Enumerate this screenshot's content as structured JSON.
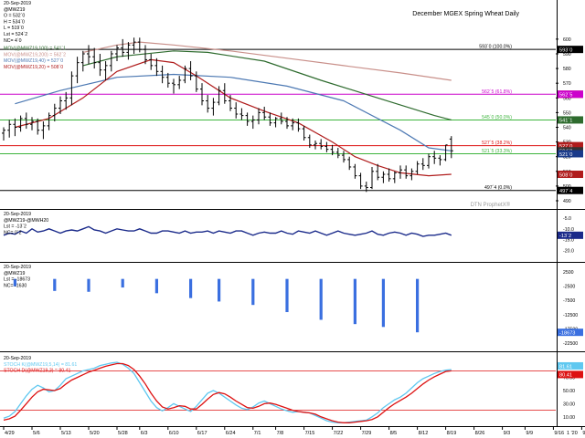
{
  "chart_data": [
    {
      "type": "ohlc",
      "title": "December MGEX Spring Wheat Daily",
      "header": [
        "20-Sep-2019",
        "@MWZ19",
        "O = 532`0",
        "H = 534`0",
        "L = 519`0",
        "Lst = 524`2",
        "NC= 4`0"
      ],
      "legend": [
        {
          "label": "MOV(@MWZ19,100) = 541`1",
          "color": "#2e6b2e"
        },
        {
          "label": "MOV(@MWZ19,200) = 562`2",
          "color": "#c9908a"
        },
        {
          "label": "MOV(@MWZ19,40) = 527`0",
          "color": "#4d79b3"
        },
        {
          "label": "MOV(@MWZ19,20) = 508`0",
          "color": "#b01c1c"
        }
      ],
      "bars": [
        [
          536,
          540,
          531,
          538
        ],
        [
          538,
          545,
          533,
          542
        ],
        [
          542,
          546,
          534,
          540
        ],
        [
          540,
          548,
          537,
          546
        ],
        [
          546,
          550,
          539,
          542
        ],
        [
          542,
          547,
          538,
          544
        ],
        [
          544,
          546,
          535,
          538
        ],
        [
          538,
          544,
          532,
          541
        ],
        [
          541,
          550,
          538,
          548
        ],
        [
          548,
          556,
          544,
          553
        ],
        [
          553,
          561,
          549,
          558
        ],
        [
          558,
          564,
          552,
          560
        ],
        [
          560,
          578,
          555,
          575
        ],
        [
          575,
          588,
          570,
          584
        ],
        [
          584,
          592,
          578,
          590
        ],
        [
          590,
          596,
          583,
          588
        ],
        [
          588,
          594,
          580,
          584
        ],
        [
          584,
          590,
          575,
          579
        ],
        [
          579,
          585,
          572,
          582
        ],
        [
          582,
          592,
          578,
          590
        ],
        [
          590,
          596,
          585,
          594
        ],
        [
          594,
          600,
          588,
          591
        ],
        [
          591,
          598,
          586,
          596
        ],
        [
          596,
          601,
          590,
          598
        ],
        [
          598,
          601,
          591,
          593
        ],
        [
          593,
          596,
          583,
          586
        ],
        [
          586,
          590,
          579,
          582
        ],
        [
          582,
          587,
          575,
          578
        ],
        [
          578,
          582,
          570,
          574
        ],
        [
          574,
          577,
          567,
          570
        ],
        [
          570,
          573,
          563,
          569
        ],
        [
          569,
          575,
          566,
          572
        ],
        [
          572,
          582,
          570,
          580
        ],
        [
          580,
          585,
          572,
          575
        ],
        [
          575,
          578,
          564,
          566
        ],
        [
          566,
          570,
          555,
          558
        ],
        [
          558,
          562,
          550,
          553
        ],
        [
          553,
          560,
          548,
          557
        ],
        [
          557,
          568,
          555,
          565
        ],
        [
          565,
          570,
          556,
          558
        ],
        [
          558,
          562,
          551,
          553
        ],
        [
          553,
          557,
          546,
          549
        ],
        [
          549,
          553,
          545,
          548
        ],
        [
          548,
          550,
          541,
          544
        ],
        [
          544,
          548,
          539,
          545
        ],
        [
          545,
          553,
          542,
          550
        ],
        [
          550,
          554,
          545,
          547
        ],
        [
          547,
          550,
          541,
          543
        ],
        [
          543,
          547,
          540,
          546
        ],
        [
          546,
          550,
          542,
          544
        ],
        [
          544,
          547,
          539,
          541
        ],
        [
          541,
          546,
          538,
          543
        ],
        [
          543,
          546,
          537,
          539
        ],
        [
          539,
          541,
          531,
          533
        ],
        [
          533,
          535,
          526,
          528
        ],
        [
          528,
          531,
          525,
          529
        ],
        [
          529,
          532,
          525,
          527
        ],
        [
          527,
          530,
          523,
          525
        ],
        [
          525,
          528,
          521,
          523
        ],
        [
          523,
          526,
          519,
          521
        ],
        [
          521,
          524,
          516,
          518
        ],
        [
          518,
          520,
          511,
          513
        ],
        [
          513,
          515,
          505,
          507
        ],
        [
          507,
          509,
          498,
          500
        ],
        [
          500,
          503,
          496,
          499
        ],
        [
          499,
          513,
          498,
          510
        ],
        [
          510,
          515,
          504,
          506
        ],
        [
          506,
          510,
          502,
          508
        ],
        [
          508,
          512,
          503,
          505
        ],
        [
          505,
          510,
          502,
          509
        ],
        [
          509,
          514,
          505,
          511
        ],
        [
          511,
          514,
          505,
          507
        ],
        [
          507,
          512,
          504,
          510
        ],
        [
          510,
          517,
          508,
          515
        ],
        [
          515,
          519,
          511,
          514
        ],
        [
          514,
          522,
          512,
          520
        ],
        [
          520,
          524,
          515,
          519
        ],
        [
          519,
          521,
          514,
          518
        ],
        [
          518,
          528,
          517,
          528
        ],
        [
          532,
          534,
          519,
          524
        ]
      ],
      "ma": [
        {
          "name": "MOV 100",
          "color": "#2e6b2e",
          "points": [
            [
              14,
              582
            ],
            [
              20,
              588
            ],
            [
              30,
              592
            ],
            [
              36,
              591
            ],
            [
              46,
              585
            ],
            [
              56,
              572
            ],
            [
              66,
              560
            ],
            [
              76,
              548
            ],
            [
              79,
              545
            ]
          ]
        },
        {
          "name": "MOV 200",
          "color": "#c9908a",
          "points": [
            [
              14,
              591
            ],
            [
              20,
              596
            ],
            [
              24,
              598
            ],
            [
              30,
              596
            ],
            [
              40,
              592
            ],
            [
              50,
              587
            ],
            [
              60,
              582
            ],
            [
              70,
              577
            ],
            [
              79,
              572
            ]
          ]
        },
        {
          "name": "MOV 40",
          "color": "#4d79b3",
          "points": [
            [
              2,
              556
            ],
            [
              10,
              565
            ],
            [
              20,
              574
            ],
            [
              30,
              576
            ],
            [
              40,
              574
            ],
            [
              50,
              568
            ],
            [
              60,
              558
            ],
            [
              70,
              538
            ],
            [
              75,
              526
            ],
            [
              79,
              524
            ]
          ]
        },
        {
          "name": "MOV 20",
          "color": "#b01c1c",
          "points": [
            [
              2,
              540
            ],
            [
              8,
              546
            ],
            [
              14,
              560
            ],
            [
              20,
              578
            ],
            [
              26,
              586
            ],
            [
              30,
              584
            ],
            [
              34,
              575
            ],
            [
              40,
              560
            ],
            [
              46,
              551
            ],
            [
              52,
              543
            ],
            [
              58,
              530
            ],
            [
              62,
              520
            ],
            [
              66,
              514
            ],
            [
              70,
              509
            ],
            [
              75,
              507
            ],
            [
              79,
              508
            ]
          ]
        }
      ],
      "levels": [
        {
          "value": 593,
          "label": "593`0 (100.0%)",
          "color": "#000000"
        },
        {
          "value": 562.5,
          "label": "562`5 (61.8%)",
          "color": "#cc00cc"
        },
        {
          "value": 545,
          "label": "545`0 (50.0%)",
          "color": "#3cb43c"
        },
        {
          "value": 527.5,
          "label": "527`5 (38.2%)",
          "color": "#dd1111"
        },
        {
          "value": 522,
          "label": "521`5 (33.3%)",
          "color": "#3cb43c"
        },
        {
          "value": 497,
          "label": "497`4 (0.0%)",
          "color": "#000000"
        }
      ],
      "price_tags": [
        {
          "value": 593,
          "label": "593`0",
          "color": "#000000"
        },
        {
          "value": 562.5,
          "label": "562`3",
          "color": "#b01c1c"
        },
        {
          "value": 562.5,
          "label": "562`5",
          "color": "#cc00cc"
        },
        {
          "value": 545,
          "label": "541`1",
          "color": "#2e6b2e"
        },
        {
          "value": 527.5,
          "label": "527`0",
          "color": "#b01c1c"
        },
        {
          "value": 524,
          "label": "524`2",
          "color": "#333333"
        },
        {
          "value": 522,
          "label": "521`0",
          "color": "#1a3a8a"
        },
        {
          "value": 508,
          "label": "508`0",
          "color": "#b01c1c"
        },
        {
          "value": 497,
          "label": "497`4",
          "color": "#000000"
        }
      ],
      "y_ticks": [
        600,
        590,
        580,
        570,
        560,
        550,
        540,
        530,
        520,
        510,
        500,
        490
      ],
      "ylim": [
        490,
        608
      ],
      "watermark": "DTN ProphetX®"
    },
    {
      "type": "line",
      "header": [
        "20-Sep-2019",
        "@MWZ19-@MWH20",
        "Lst = -13`2",
        "NC= 0`2"
      ],
      "color": "#1a2a8a",
      "values": [
        -13,
        -12,
        -12.5,
        -11,
        -12,
        -10,
        -11.5,
        -11,
        -10,
        -11,
        -12,
        -11,
        -10.5,
        -11,
        -10,
        -9,
        -10.5,
        -11,
        -12,
        -11,
        -10,
        -10.5,
        -11,
        -11,
        -10,
        -11,
        -12,
        -12,
        -11,
        -11,
        -11.5,
        -12,
        -11,
        -12,
        -11.5,
        -11.5,
        -11,
        -12,
        -11,
        -11.5,
        -12,
        -11,
        -11,
        -12,
        -13,
        -12,
        -11.5,
        -12,
        -12,
        -11,
        -12,
        -12.5,
        -11,
        -11.5,
        -12,
        -11,
        -12,
        -13,
        -12,
        -11,
        -12,
        -12.5,
        -13,
        -12.5,
        -12,
        -11,
        -12.5,
        -13,
        -12,
        -11.5,
        -12,
        -13,
        -12,
        -12.5,
        -13.5,
        -13,
        -13,
        -12.5,
        -12,
        -13
      ],
      "ylim": [
        -25,
        -2
      ],
      "y_ticks": [
        "-5.0",
        "-10.0",
        "-15.0",
        "-20.0"
      ],
      "price_tags": [
        {
          "label": "-13`2",
          "color": "#1a2a8a"
        }
      ]
    },
    {
      "type": "bar",
      "header": [
        "20-Sep-2019",
        "@MWZ19",
        "Lst = -18673",
        "NC= -1630"
      ],
      "color": "#3a6fe0",
      "bars": [
        [
          2,
          -2600
        ],
        [
          9,
          -4200
        ],
        [
          15,
          -4500
        ],
        [
          21,
          -3000
        ],
        [
          27,
          -5000
        ],
        [
          33,
          -6700
        ],
        [
          38,
          -7900
        ],
        [
          44,
          -9100
        ],
        [
          50,
          -11600
        ],
        [
          56,
          -14300
        ],
        [
          62,
          -15800
        ],
        [
          67,
          -16800
        ],
        [
          73,
          -18673
        ]
      ],
      "ylim": [
        -25000,
        5000
      ],
      "y_ticks": [
        "2500",
        "-2500",
        "-7500",
        "-12500",
        "-17500",
        "-22500"
      ],
      "price_tags": [
        {
          "label": "-18673",
          "color": "#3a6fe0"
        }
      ]
    },
    {
      "type": "line",
      "header": [
        "20-Sep-2019",
        "STOCH K(@MWZ19,5,14) = 81.61",
        "STOCH D(@MWZ19,3) = 80.41"
      ],
      "series": [
        {
          "name": "STOCH K",
          "color": "#5fc8f0",
          "values": [
            8,
            11,
            18,
            30,
            42,
            52,
            58,
            54,
            48,
            50,
            58,
            68,
            72,
            76,
            80,
            82,
            84,
            88,
            90,
            92,
            93,
            90,
            84,
            76,
            62,
            48,
            34,
            24,
            19,
            24,
            30,
            26,
            22,
            18,
            26,
            36,
            46,
            50,
            46,
            40,
            34,
            28,
            23,
            21,
            25,
            31,
            34,
            30,
            26,
            22,
            19,
            17,
            18,
            17,
            16,
            12,
            8,
            4,
            2,
            1,
            1,
            2,
            3,
            4,
            5,
            10,
            16,
            24,
            30,
            36,
            40,
            46,
            54,
            62,
            68,
            72,
            76,
            79,
            81,
            82
          ]
        },
        {
          "name": "STOCH D",
          "color": "#dd1111",
          "values": [
            5,
            7,
            11,
            20,
            30,
            40,
            48,
            52,
            51,
            50,
            53,
            60,
            66,
            70,
            74,
            78,
            81,
            84,
            87,
            89,
            91,
            91,
            88,
            82,
            72,
            60,
            46,
            34,
            25,
            22,
            24,
            27,
            26,
            22,
            22,
            29,
            37,
            44,
            47,
            45,
            40,
            34,
            29,
            24,
            23,
            26,
            30,
            31,
            29,
            26,
            23,
            20,
            18,
            17,
            16,
            14,
            10,
            7,
            4,
            2,
            1,
            1,
            2,
            3,
            4,
            6,
            10,
            17,
            24,
            30,
            35,
            40,
            46,
            53,
            60,
            66,
            71,
            75,
            79,
            80
          ]
        }
      ],
      "levels": [
        80,
        20
      ],
      "ylim": [
        0,
        100
      ],
      "y_ticks": [
        "90.00",
        "70.00",
        "50.00",
        "30.00",
        "10.00"
      ],
      "price_tags": [
        {
          "label": "81.61",
          "color": "#5fc8f0"
        },
        {
          "label": "80.41",
          "color": "#dd1111"
        }
      ]
    }
  ],
  "x_axis": {
    "labels": [
      "4/29",
      "5/6",
      "5/13",
      "5/20",
      "5/28",
      "6/3",
      "6/10",
      "6/17",
      "6/24",
      "7/1",
      "7/8",
      "7/15",
      "7/22",
      "7/29",
      "8/5",
      "8/12",
      "8/19",
      "8/26",
      "9/3",
      "9/9",
      "9/16",
      "9/23"
    ],
    "bar_index": [
      0,
      5,
      10,
      15,
      20,
      24,
      29,
      34,
      39,
      44,
      48,
      53,
      58,
      63,
      68,
      73,
      78,
      83,
      88,
      92,
      97,
      102
    ],
    "extra_label": "1 '20"
  }
}
